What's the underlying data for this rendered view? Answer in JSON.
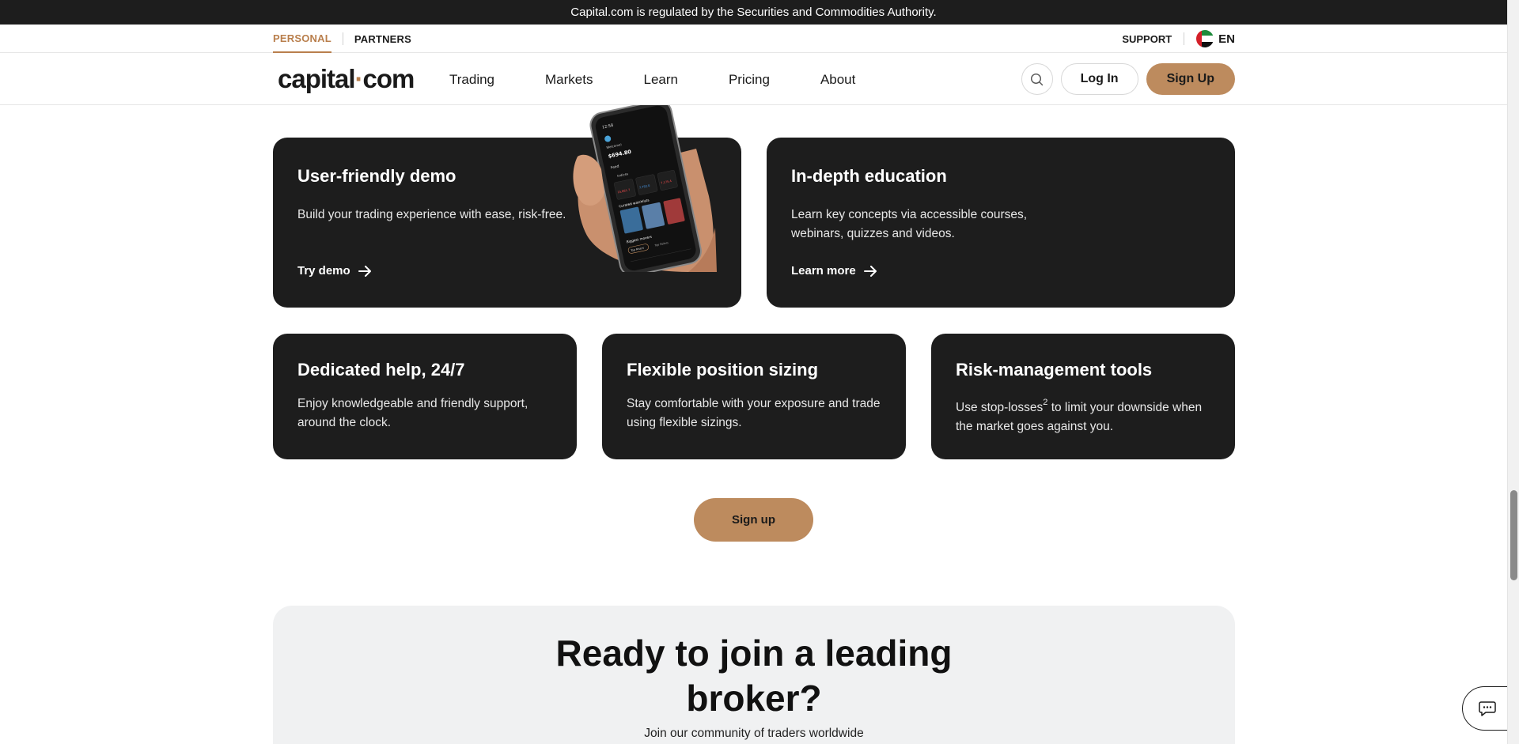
{
  "banner": {
    "text": "Capital.com is regulated by the Securities and Commodities Authority."
  },
  "sub_nav": {
    "tabs": [
      {
        "label": "PERSONAL",
        "active": true
      },
      {
        "label": "PARTNERS",
        "active": false
      }
    ],
    "support_label": "SUPPORT",
    "language": "EN"
  },
  "header": {
    "logo_main": "capital",
    "logo_dot": "·",
    "logo_end": "com",
    "menu": [
      "Trading",
      "Markets",
      "Learn",
      "Pricing",
      "About"
    ],
    "login_label": "Log In",
    "signup_label": "Sign Up"
  },
  "features": {
    "demo": {
      "title": "User-friendly demo",
      "text": "Build your trading experience with ease, risk-free.",
      "link": "Try demo"
    },
    "education": {
      "title": "In-depth education",
      "text": "Learn key concepts via accessible courses, webinars, quizzes and videos.",
      "link": "Learn more"
    },
    "help": {
      "title": "Dedicated help, 24/7",
      "text": "Enjoy knowledgeable and friendly support, around the clock."
    },
    "sizing": {
      "title": "Flexible position sizing",
      "text": "Stay comfortable with your exposure and trade using flexible sizings."
    },
    "risk": {
      "title": "Risk-management tools",
      "text_before": "Use stop-losses",
      "footnote": "2",
      "text_after": " to limit your downside when the market goes against you."
    }
  },
  "phone_mock": {
    "time": "12:58",
    "greeting": "Welcome!",
    "balance": "$694.80",
    "section_feed": "Feed",
    "section_indices": "Indices",
    "section_curated": "Curated watchlists",
    "section_biggest": "Biggest movers",
    "chip_top_risers": "Top Risers",
    "chip_top_fallers": "Top Fallers",
    "quote_1": "15,861.7",
    "quote_2": "7,752.0",
    "quote_3": "7,175.4"
  },
  "cta": {
    "signup_label": "Sign up"
  },
  "ready": {
    "title_line1": "Ready to join a leading",
    "title_line2": "broker?",
    "subtitle": "Join our community of traders worldwide"
  },
  "colors": {
    "accent": "#bd8b5e",
    "accent_text": "#b97f4d",
    "card_bg": "#1d1d1d",
    "banner_bg": "#1d1d1d",
    "section_bg": "#f0f1f2"
  },
  "icons": {
    "search": "search-icon",
    "arrow": "arrow-right-icon",
    "chat": "chat-bubble-icon",
    "flag": "uae-flag-icon"
  }
}
